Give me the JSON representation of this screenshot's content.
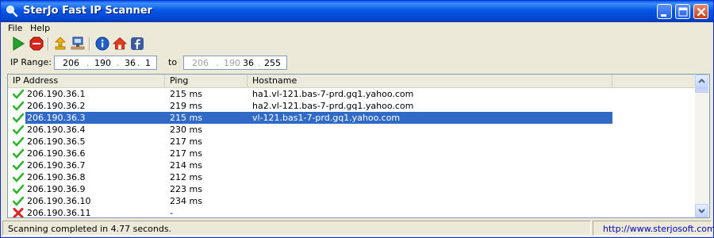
{
  "window": {
    "title": "SterJo Fast IP Scanner"
  },
  "menu": {
    "items": [
      "File",
      "Help"
    ]
  },
  "toolbar": {
    "icons": [
      "start-icon",
      "stop-icon",
      "export-icon",
      "network-icon",
      "info-icon",
      "home-icon",
      "facebook-icon"
    ]
  },
  "range": {
    "label": "IP Range:",
    "to_label": "to",
    "from_ip": [
      "206",
      "190",
      "36",
      "1"
    ],
    "to_ip": [
      "206",
      "190",
      "36",
      "255"
    ]
  },
  "list": {
    "columns": [
      "IP Address",
      "Ping",
      "Hostname"
    ],
    "rows": [
      {
        "status": "ok",
        "ip": "206.190.36.1",
        "ping": "215 ms",
        "hostname": "ha1.vl-121.bas-7-prd.gq1.yahoo.com"
      },
      {
        "status": "ok",
        "ip": "206.190.36.2",
        "ping": "219 ms",
        "hostname": "ha2.vl-121.bas-7-prd.gq1.yahoo.com"
      },
      {
        "status": "ok",
        "ip": "206.190.36.3",
        "ping": "215 ms",
        "hostname": "vl-121.bas1-7-prd.gq1.yahoo.com",
        "selected": true
      },
      {
        "status": "ok",
        "ip": "206.190.36.4",
        "ping": "230 ms",
        "hostname": ""
      },
      {
        "status": "ok",
        "ip": "206.190.36.5",
        "ping": "217 ms",
        "hostname": ""
      },
      {
        "status": "ok",
        "ip": "206.190.36.6",
        "ping": "217 ms",
        "hostname": ""
      },
      {
        "status": "ok",
        "ip": "206.190.36.7",
        "ping": "214 ms",
        "hostname": ""
      },
      {
        "status": "ok",
        "ip": "206.190.36.8",
        "ping": "212 ms",
        "hostname": ""
      },
      {
        "status": "ok",
        "ip": "206.190.36.9",
        "ping": "223 ms",
        "hostname": ""
      },
      {
        "status": "ok",
        "ip": "206.190.36.10",
        "ping": "234 ms",
        "hostname": ""
      },
      {
        "status": "fail",
        "ip": "206.190.36.11",
        "ping": "-",
        "hostname": ""
      }
    ]
  },
  "status": {
    "message": "Scanning completed in 4.77 seconds.",
    "link": "http://www.sterjosoft.com"
  },
  "colors": {
    "selection": "#316ac5",
    "link": "#0000cc"
  }
}
